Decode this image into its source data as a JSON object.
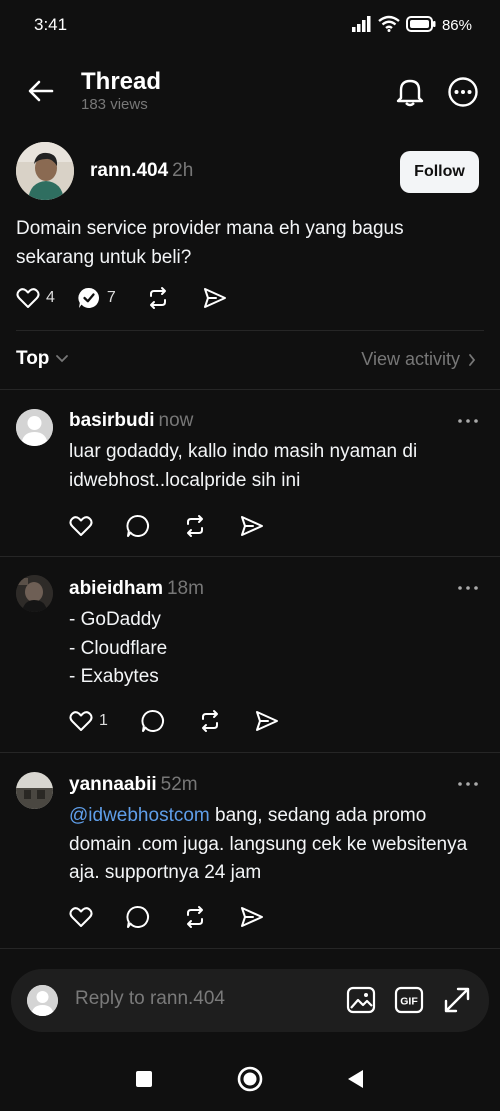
{
  "status_bar": {
    "time": "3:41",
    "battery": "86%"
  },
  "header": {
    "title": "Thread",
    "views": "183 views"
  },
  "post": {
    "username": "rann.404",
    "time": "2h",
    "follow_label": "Follow",
    "text": "Domain service provider mana eh yang bagus sekarang untuk beli?",
    "likes": "4",
    "replies": "7"
  },
  "sort": {
    "label": "Top",
    "view_activity": "View activity"
  },
  "replies": [
    {
      "username": "basirbudi",
      "time": "now",
      "text": "luar godaddy, kallo indo masih nyaman di idwebhost..localpride sih ini",
      "likes": ""
    },
    {
      "username": "abieidham",
      "time": "18m",
      "lines": [
        "- GoDaddy",
        "- Cloudflare",
        "- Exabytes"
      ],
      "likes": "1"
    },
    {
      "username": "yannaabii",
      "time": "52m",
      "mention": "@idwebhostcom",
      "text": " bang, sedang ada promo domain .com juga. langsung cek ke websitenya aja. supportnya 24 jam",
      "likes": ""
    }
  ],
  "composer": {
    "placeholder": "Reply to rann.404"
  },
  "icons": {
    "status": [
      "signal-icon",
      "wifi-icon",
      "battery-icon"
    ],
    "header": [
      "back-arrow-icon",
      "bell-icon",
      "more-icon"
    ],
    "actions": [
      "heart-icon",
      "reply-icon",
      "repost-icon",
      "share-icon"
    ],
    "composer": [
      "image-icon",
      "gif-icon",
      "expand-icon"
    ],
    "nav": [
      "square-icon",
      "home-circle-icon",
      "back-triangle-icon"
    ]
  },
  "colors": {
    "background": "#101010",
    "text": "#f3f5f7",
    "muted": "#777777",
    "mention": "#5f9ee9",
    "composer": "#1e1e1e"
  }
}
